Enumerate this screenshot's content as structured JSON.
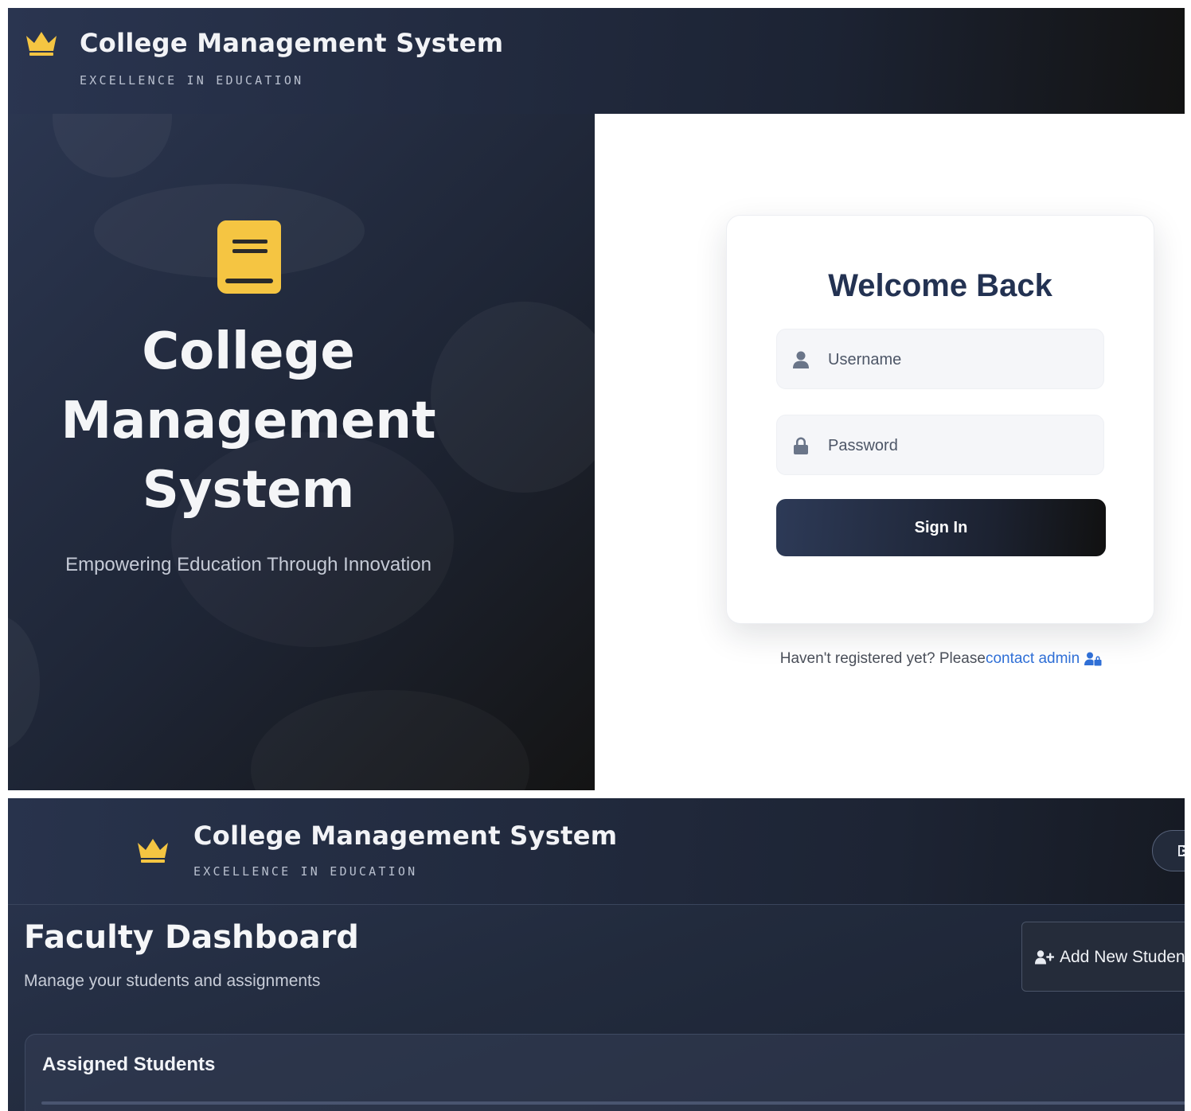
{
  "login_page": {
    "header": {
      "title": "College Management System",
      "subtitle": "EXCELLENCE IN EDUCATION",
      "logo_icon": "crown-icon"
    },
    "hero": {
      "icon": "book-icon",
      "title_line1": "College",
      "title_line2": "Management",
      "title_line3": "System",
      "tagline": "Empowering Education Through Innovation"
    },
    "form": {
      "heading": "Welcome Back",
      "username_placeholder": "Username",
      "username_icon": "user-icon",
      "password_placeholder": "Password",
      "password_icon": "lock-icon",
      "submit_label": "Sign In",
      "register_prompt": "Haven't registered yet? Please",
      "register_link": "contact admin",
      "register_icon": "user-lock-icon"
    }
  },
  "dashboard_page": {
    "header": {
      "title": "College Management System",
      "subtitle": "EXCELLENCE IN EDUCATION",
      "logo_icon": "crown-icon",
      "logout_icon": "logout-icon"
    },
    "title": "Faculty Dashboard",
    "subtitle": "Manage your students and assignments",
    "add_button_label": "Add New Student",
    "add_button_icon": "user-plus-icon",
    "assigned_panel_title": "Assigned Students"
  },
  "colors": {
    "brand_dark": "#1d2433",
    "brand_navy": "#233252",
    "accent_gold": "#f5c542",
    "link_blue": "#2f6fd6"
  }
}
